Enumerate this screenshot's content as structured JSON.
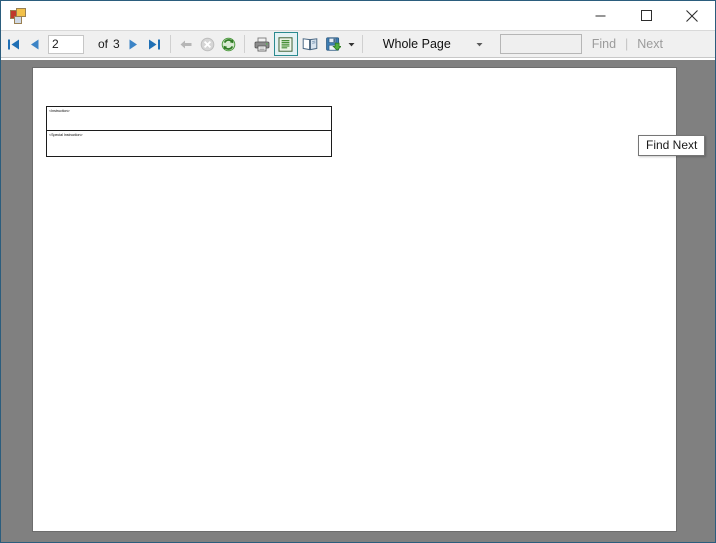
{
  "window": {
    "title": "",
    "app_icon": "report-viewer-app-icon",
    "frame_color": "#2b5d7d",
    "controls": {
      "minimize": "minimize-icon",
      "maximize": "maximize-icon",
      "close": "close-icon"
    }
  },
  "toolbar": {
    "first_page": "first-page-icon",
    "previous_page": "previous-page-icon",
    "page_number": "2",
    "page_number_placeholder": "",
    "of_label": "of",
    "total_pages": "3",
    "next_page": "next-page-icon",
    "last_page": "last-page-icon",
    "back": "back-navigation-icon",
    "stop": "stop-icon",
    "refresh": "refresh-icon",
    "print": "print-icon",
    "page_layout": "page-layout-icon",
    "page_setup": "page-setup-icon",
    "export": "export-save-icon",
    "export_caret": "chevron-down-icon",
    "zoom_value": "Whole Page",
    "zoom_caret": "chevron-down-icon",
    "find_value": "",
    "find_placeholder": "",
    "find_label": "Find",
    "find_divider": "|",
    "next_label": "Next",
    "selected_tool": "page-layout-icon",
    "accent_selected": "#2a8a8f"
  },
  "tooltip": {
    "text": "Find Next"
  },
  "viewer": {
    "background_color": "#808080",
    "page_background": "#ffffff",
    "page_border": "#6d6d6d",
    "report": {
      "rows": [
        {
          "text": "<Instruction>"
        },
        {
          "text": "<Special Instruction>"
        }
      ]
    }
  }
}
